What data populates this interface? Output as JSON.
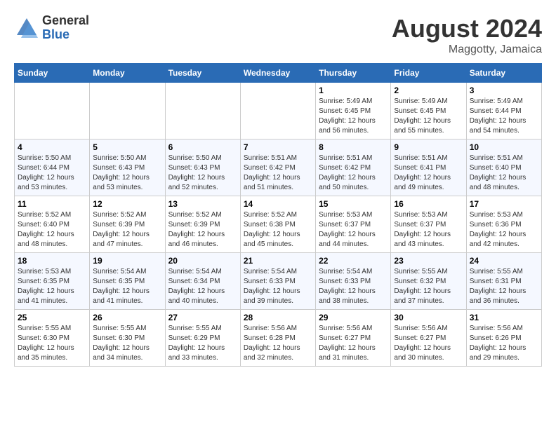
{
  "header": {
    "logo_general": "General",
    "logo_blue": "Blue",
    "month_year": "August 2024",
    "location": "Maggotty, Jamaica"
  },
  "calendar": {
    "days_of_week": [
      "Sunday",
      "Monday",
      "Tuesday",
      "Wednesday",
      "Thursday",
      "Friday",
      "Saturday"
    ],
    "weeks": [
      [
        {
          "day": "",
          "info": ""
        },
        {
          "day": "",
          "info": ""
        },
        {
          "day": "",
          "info": ""
        },
        {
          "day": "",
          "info": ""
        },
        {
          "day": "1",
          "info": "Sunrise: 5:49 AM\nSunset: 6:45 PM\nDaylight: 12 hours\nand 56 minutes."
        },
        {
          "day": "2",
          "info": "Sunrise: 5:49 AM\nSunset: 6:45 PM\nDaylight: 12 hours\nand 55 minutes."
        },
        {
          "day": "3",
          "info": "Sunrise: 5:49 AM\nSunset: 6:44 PM\nDaylight: 12 hours\nand 54 minutes."
        }
      ],
      [
        {
          "day": "4",
          "info": "Sunrise: 5:50 AM\nSunset: 6:44 PM\nDaylight: 12 hours\nand 53 minutes."
        },
        {
          "day": "5",
          "info": "Sunrise: 5:50 AM\nSunset: 6:43 PM\nDaylight: 12 hours\nand 53 minutes."
        },
        {
          "day": "6",
          "info": "Sunrise: 5:50 AM\nSunset: 6:43 PM\nDaylight: 12 hours\nand 52 minutes."
        },
        {
          "day": "7",
          "info": "Sunrise: 5:51 AM\nSunset: 6:42 PM\nDaylight: 12 hours\nand 51 minutes."
        },
        {
          "day": "8",
          "info": "Sunrise: 5:51 AM\nSunset: 6:42 PM\nDaylight: 12 hours\nand 50 minutes."
        },
        {
          "day": "9",
          "info": "Sunrise: 5:51 AM\nSunset: 6:41 PM\nDaylight: 12 hours\nand 49 minutes."
        },
        {
          "day": "10",
          "info": "Sunrise: 5:51 AM\nSunset: 6:40 PM\nDaylight: 12 hours\nand 48 minutes."
        }
      ],
      [
        {
          "day": "11",
          "info": "Sunrise: 5:52 AM\nSunset: 6:40 PM\nDaylight: 12 hours\nand 48 minutes."
        },
        {
          "day": "12",
          "info": "Sunrise: 5:52 AM\nSunset: 6:39 PM\nDaylight: 12 hours\nand 47 minutes."
        },
        {
          "day": "13",
          "info": "Sunrise: 5:52 AM\nSunset: 6:39 PM\nDaylight: 12 hours\nand 46 minutes."
        },
        {
          "day": "14",
          "info": "Sunrise: 5:52 AM\nSunset: 6:38 PM\nDaylight: 12 hours\nand 45 minutes."
        },
        {
          "day": "15",
          "info": "Sunrise: 5:53 AM\nSunset: 6:37 PM\nDaylight: 12 hours\nand 44 minutes."
        },
        {
          "day": "16",
          "info": "Sunrise: 5:53 AM\nSunset: 6:37 PM\nDaylight: 12 hours\nand 43 minutes."
        },
        {
          "day": "17",
          "info": "Sunrise: 5:53 AM\nSunset: 6:36 PM\nDaylight: 12 hours\nand 42 minutes."
        }
      ],
      [
        {
          "day": "18",
          "info": "Sunrise: 5:53 AM\nSunset: 6:35 PM\nDaylight: 12 hours\nand 41 minutes."
        },
        {
          "day": "19",
          "info": "Sunrise: 5:54 AM\nSunset: 6:35 PM\nDaylight: 12 hours\nand 41 minutes."
        },
        {
          "day": "20",
          "info": "Sunrise: 5:54 AM\nSunset: 6:34 PM\nDaylight: 12 hours\nand 40 minutes."
        },
        {
          "day": "21",
          "info": "Sunrise: 5:54 AM\nSunset: 6:33 PM\nDaylight: 12 hours\nand 39 minutes."
        },
        {
          "day": "22",
          "info": "Sunrise: 5:54 AM\nSunset: 6:33 PM\nDaylight: 12 hours\nand 38 minutes."
        },
        {
          "day": "23",
          "info": "Sunrise: 5:55 AM\nSunset: 6:32 PM\nDaylight: 12 hours\nand 37 minutes."
        },
        {
          "day": "24",
          "info": "Sunrise: 5:55 AM\nSunset: 6:31 PM\nDaylight: 12 hours\nand 36 minutes."
        }
      ],
      [
        {
          "day": "25",
          "info": "Sunrise: 5:55 AM\nSunset: 6:30 PM\nDaylight: 12 hours\nand 35 minutes."
        },
        {
          "day": "26",
          "info": "Sunrise: 5:55 AM\nSunset: 6:30 PM\nDaylight: 12 hours\nand 34 minutes."
        },
        {
          "day": "27",
          "info": "Sunrise: 5:55 AM\nSunset: 6:29 PM\nDaylight: 12 hours\nand 33 minutes."
        },
        {
          "day": "28",
          "info": "Sunrise: 5:56 AM\nSunset: 6:28 PM\nDaylight: 12 hours\nand 32 minutes."
        },
        {
          "day": "29",
          "info": "Sunrise: 5:56 AM\nSunset: 6:27 PM\nDaylight: 12 hours\nand 31 minutes."
        },
        {
          "day": "30",
          "info": "Sunrise: 5:56 AM\nSunset: 6:27 PM\nDaylight: 12 hours\nand 30 minutes."
        },
        {
          "day": "31",
          "info": "Sunrise: 5:56 AM\nSunset: 6:26 PM\nDaylight: 12 hours\nand 29 minutes."
        }
      ]
    ]
  }
}
